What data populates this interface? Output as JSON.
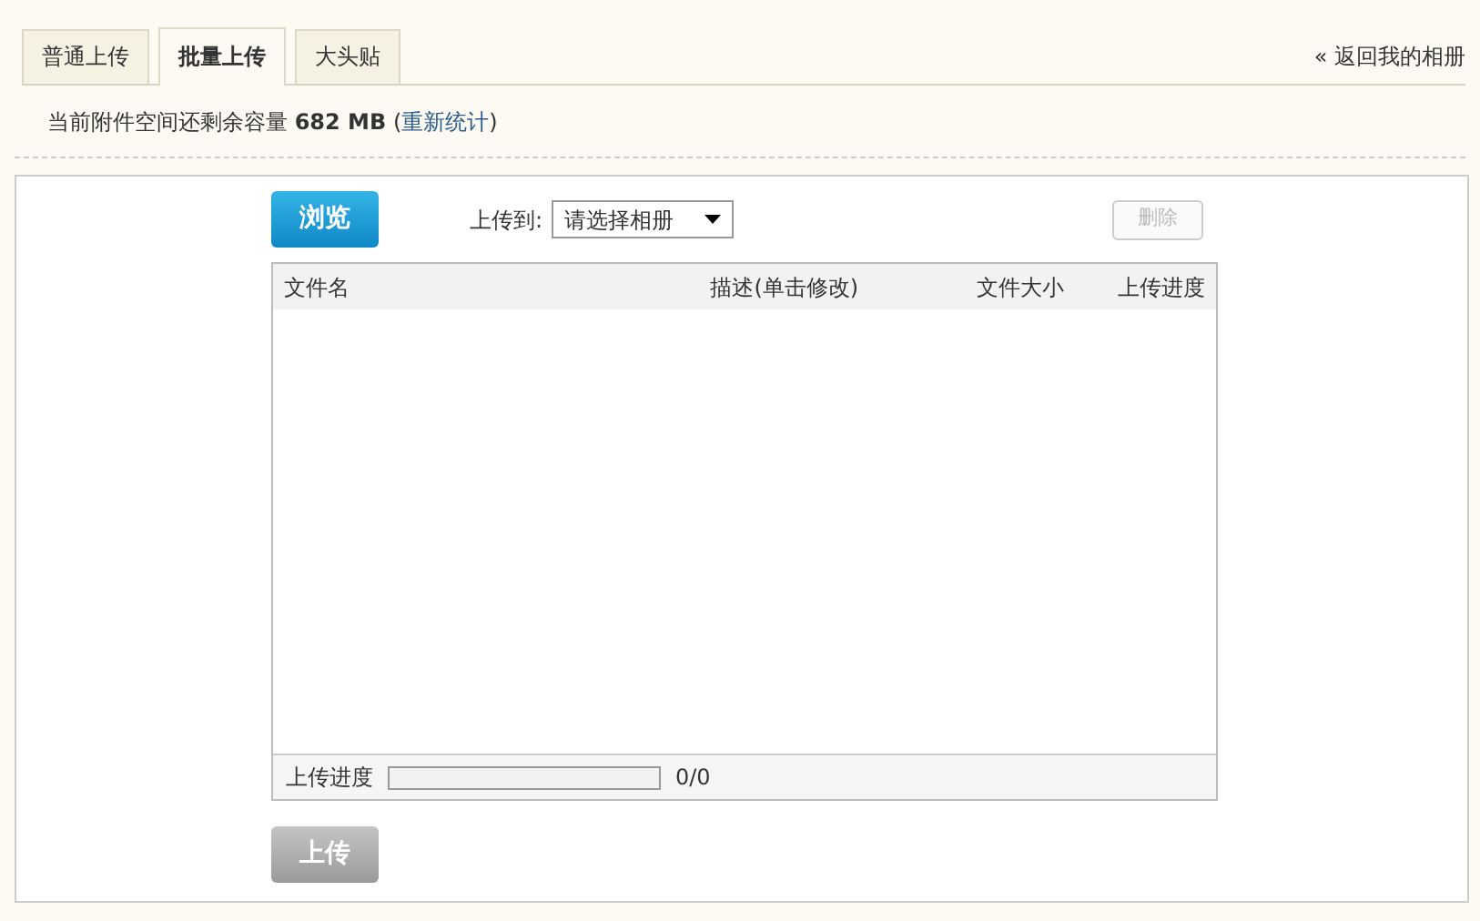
{
  "tabs": [
    {
      "label": "普通上传",
      "selected": false
    },
    {
      "label": "批量上传",
      "selected": true
    },
    {
      "label": "大头贴",
      "selected": false
    }
  ],
  "back_link": {
    "arrow": "«",
    "label": "返回我的相册"
  },
  "quota": {
    "text": "当前附件空间还剩余容量 **682 MB** (",
    "link": "重新统计",
    "suffix": ")"
  },
  "browse_button": {
    "label": "浏览",
    "disabled": false
  },
  "upload_to": {
    "label": "上传到:",
    "value": "请选择相册"
  },
  "delete_button": {
    "label": "删除",
    "disabled": true
  },
  "file_table": {
    "columns": [
      "文件名",
      "描述(单击修改)",
      "文件大小",
      "上传进度"
    ]
  },
  "progress": {
    "label": "上传进度",
    "level": 0,
    "reading": "0/0"
  },
  "upload_button": {
    "label": "上传",
    "disabled": true
  }
}
